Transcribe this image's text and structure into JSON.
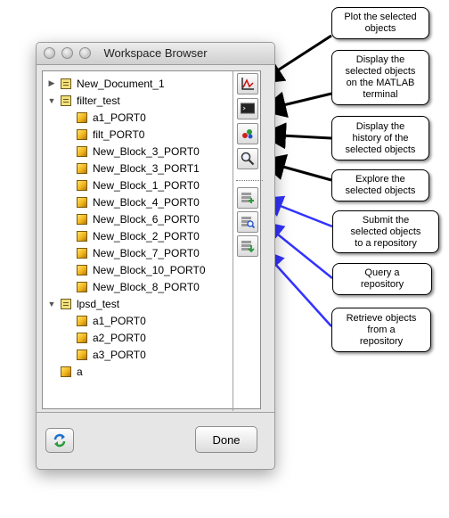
{
  "window": {
    "title": "Workspace Browser"
  },
  "tree": {
    "items": [
      {
        "label": "New_Document_1",
        "level": 0,
        "expanded": false,
        "icon": "document-icon"
      },
      {
        "label": "filter_test",
        "level": 0,
        "expanded": true,
        "icon": "document-icon"
      },
      {
        "label": "a1_PORT0",
        "level": 1,
        "icon": "cube-icon"
      },
      {
        "label": "filt_PORT0",
        "level": 1,
        "icon": "cube-icon"
      },
      {
        "label": "New_Block_3_PORT0",
        "level": 1,
        "icon": "cube-icon"
      },
      {
        "label": "New_Block_3_PORT1",
        "level": 1,
        "icon": "cube-icon"
      },
      {
        "label": "New_Block_1_PORT0",
        "level": 1,
        "icon": "cube-icon"
      },
      {
        "label": "New_Block_4_PORT0",
        "level": 1,
        "icon": "cube-icon"
      },
      {
        "label": "New_Block_6_PORT0",
        "level": 1,
        "icon": "cube-icon"
      },
      {
        "label": "New_Block_2_PORT0",
        "level": 1,
        "icon": "cube-icon"
      },
      {
        "label": "New_Block_7_PORT0",
        "level": 1,
        "icon": "cube-icon"
      },
      {
        "label": "New_Block_10_PORT0",
        "level": 1,
        "icon": "cube-icon"
      },
      {
        "label": "New_Block_8_PORT0",
        "level": 1,
        "icon": "cube-icon"
      },
      {
        "label": "lpsd_test",
        "level": 0,
        "expanded": true,
        "icon": "document-icon"
      },
      {
        "label": "a1_PORT0",
        "level": 1,
        "icon": "cube-icon"
      },
      {
        "label": "a2_PORT0",
        "level": 1,
        "icon": "cube-icon"
      },
      {
        "label": "a3_PORT0",
        "level": 1,
        "icon": "cube-icon"
      },
      {
        "label": "a",
        "level": 0,
        "icon": "cube-icon"
      }
    ]
  },
  "buttons": {
    "done_label": "Done"
  },
  "toolbar": [
    {
      "name": "plot-button",
      "icon": "plot-icon"
    },
    {
      "name": "display-terminal-button",
      "icon": "terminal-icon"
    },
    {
      "name": "history-button",
      "icon": "history-icon"
    },
    {
      "name": "explore-button",
      "icon": "magnifier-icon"
    },
    {
      "name": "submit-button",
      "icon": "submit-icon"
    },
    {
      "name": "query-button",
      "icon": "query-icon"
    },
    {
      "name": "retrieve-button",
      "icon": "retrieve-icon"
    }
  ],
  "callouts": [
    {
      "text": "Plot the selected\nobjects",
      "arrow_color": "#000000"
    },
    {
      "text": "Display the\nselected objects\non the MATLAB\nterminal",
      "arrow_color": "#000000"
    },
    {
      "text": "Display the\nhistory of the\nselected objects",
      "arrow_color": "#000000"
    },
    {
      "text": "Explore the\nselected objects",
      "arrow_color": "#000000"
    },
    {
      "text": "Submit the\nselected objects\nto a repository",
      "arrow_color": "#3333ff"
    },
    {
      "text": "Query a\nrepository",
      "arrow_color": "#3333ff"
    },
    {
      "text": "Retrieve objects\nfrom a\nrepository",
      "arrow_color": "#3333ff"
    }
  ]
}
